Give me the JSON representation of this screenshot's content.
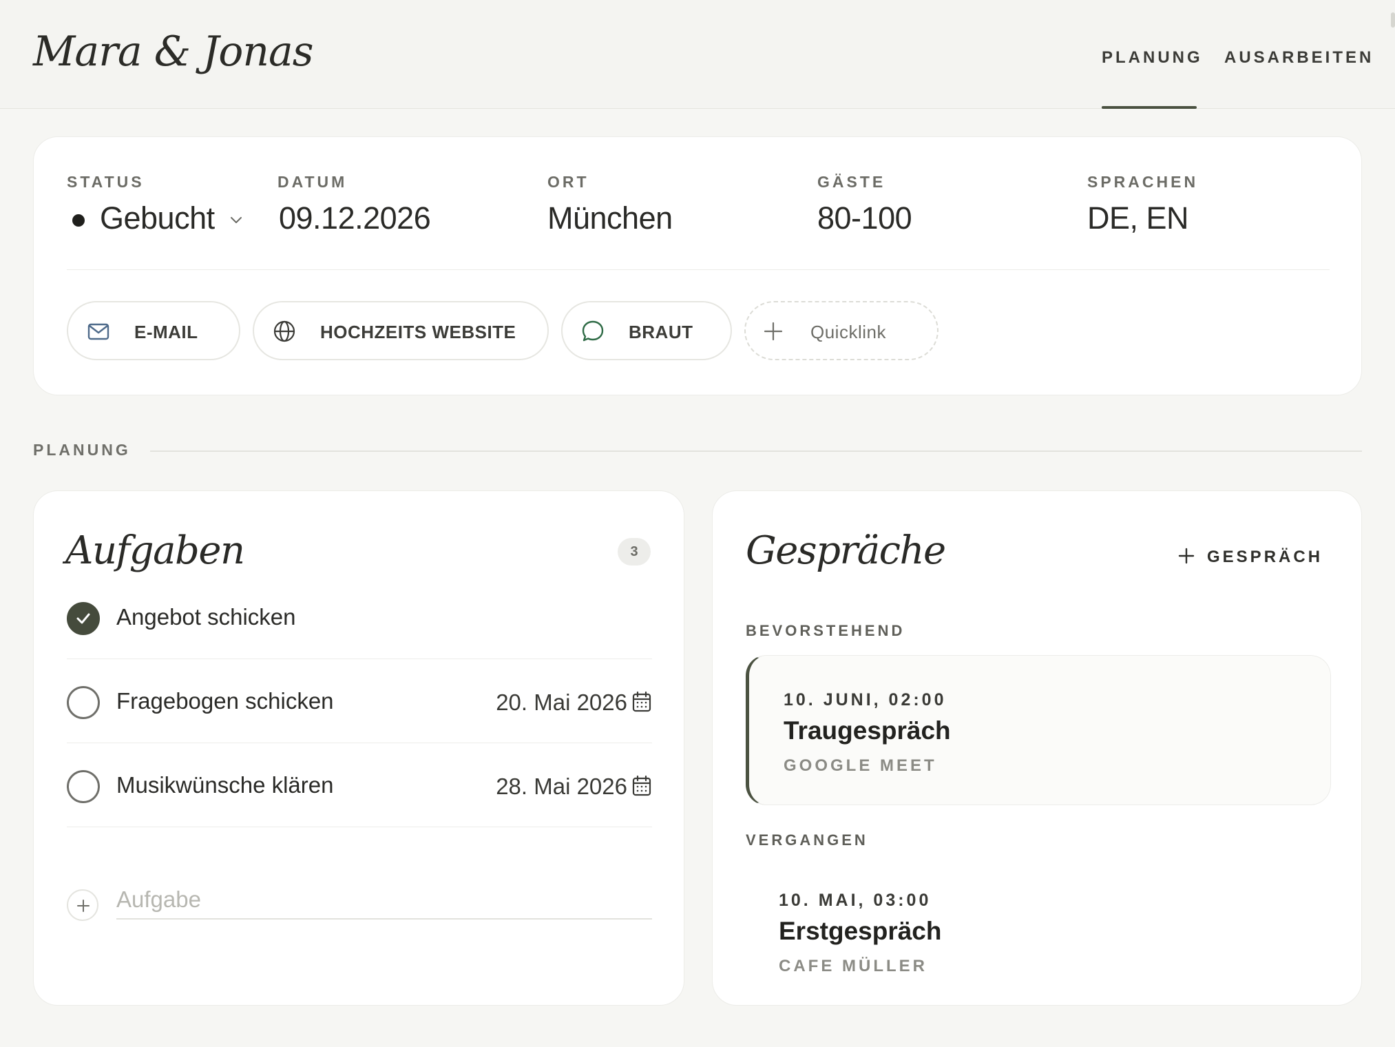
{
  "header": {
    "brand": "Mara & Jonas",
    "tabs": [
      {
        "label": "PLANUNG",
        "active": true
      },
      {
        "label": "AUSARBEITEN",
        "active": false
      }
    ]
  },
  "overview": {
    "status": {
      "label": "STATUS",
      "value": "Gebucht"
    },
    "date": {
      "label": "DATUM",
      "value": "09.12.2026"
    },
    "place": {
      "label": "ORT",
      "value": "München"
    },
    "guests": {
      "label": "GÄSTE",
      "value": "80-100"
    },
    "languages": {
      "label": "SPRACHEN",
      "value": "DE, EN"
    },
    "links": [
      {
        "label": "E-MAIL",
        "icon": "mail-icon"
      },
      {
        "label": "HOCHZEITS WEBSITE",
        "icon": "globe-icon"
      },
      {
        "label": "BRAUT",
        "icon": "chat-bubble-icon"
      },
      {
        "label": "Quicklink",
        "icon": "plus-icon"
      }
    ]
  },
  "section": {
    "label": "PLANUNG"
  },
  "tasks": {
    "title": "Aufgaben",
    "count": "3",
    "items": [
      {
        "title": "Angebot schicken",
        "done": true,
        "due": ""
      },
      {
        "title": "Fragebogen schicken",
        "done": false,
        "due": "20. Mai 2026"
      },
      {
        "title": "Musikwünsche klären",
        "done": false,
        "due": "28. Mai 2026"
      }
    ],
    "new_placeholder": "Aufgabe"
  },
  "talks": {
    "title": "Gespräche",
    "add_label": "GESPRÄCH",
    "upcoming_label": "BEVORSTEHEND",
    "past_label": "VERGANGEN",
    "upcoming": [
      {
        "time": "10. JUNI, 02:00",
        "title": "Traugespräch",
        "location": "GOOGLE MEET"
      }
    ],
    "past": [
      {
        "time": "10. MAI, 03:00",
        "title": "Erstgespräch",
        "location": "CAFE MÜLLER"
      }
    ]
  },
  "colors": {
    "background": "#f6f6f3",
    "card": "#ffffff",
    "accent": "#454b3c",
    "text": "#2a2a27",
    "muted": "#6c6c66"
  }
}
